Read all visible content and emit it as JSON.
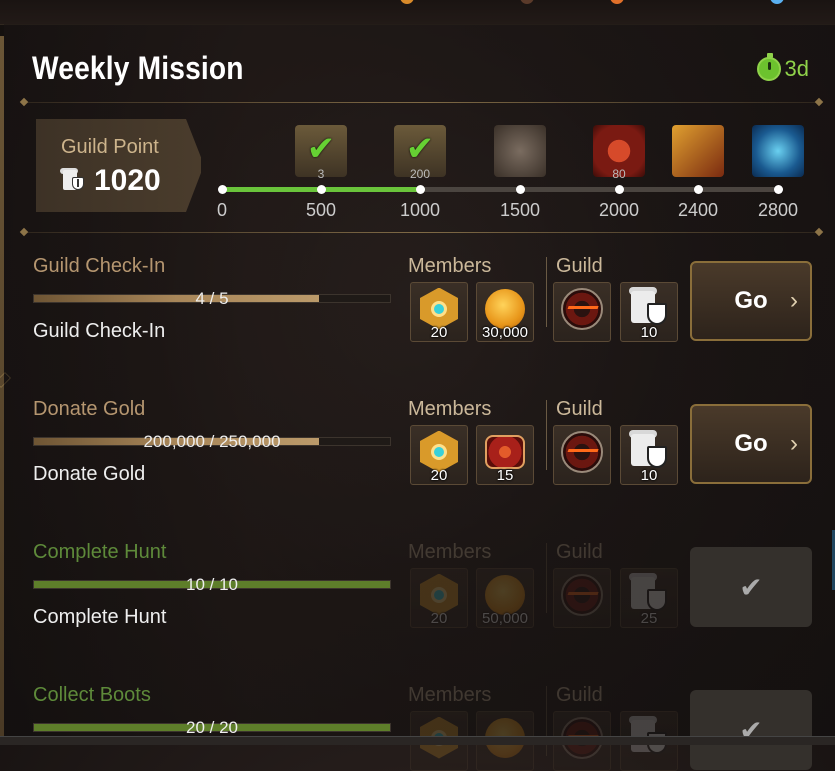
{
  "window": {
    "title": "Weekly Mission",
    "timer": "3d"
  },
  "guild_point": {
    "label": "Guild Point",
    "value": "1020",
    "progress_fraction": 0.3643
  },
  "milestones": [
    {
      "value": "0"
    },
    {
      "value": "500",
      "count": "3",
      "claimed": true,
      "icon": "check-reward-icon"
    },
    {
      "value": "1000",
      "count": "200",
      "claimed": true,
      "icon": "check-reward-icon"
    },
    {
      "value": "1500",
      "count": "",
      "claimed": false,
      "icon": "chest-icon"
    },
    {
      "value": "2000",
      "count": "80",
      "claimed": false,
      "icon": "ring-icon"
    },
    {
      "value": "2400",
      "count": "",
      "claimed": false,
      "icon": "boots-icon"
    },
    {
      "value": "2800",
      "count": "",
      "claimed": false,
      "icon": "blue-chest-icon"
    }
  ],
  "labels": {
    "members": "Members",
    "guild": "Guild",
    "go": "Go"
  },
  "missions": [
    {
      "title": "Guild Check-In",
      "progress_text": "4 / 5",
      "progress": 0.8,
      "desc": "Guild Check-In",
      "member_rewards": [
        {
          "icon": "medal-icon",
          "qty": "20"
        },
        {
          "icon": "gold-coin-icon",
          "qty": "30,000"
        }
      ],
      "guild_rewards": [
        {
          "icon": "lava-orb-icon",
          "qty": ""
        },
        {
          "icon": "guild-scroll-icon",
          "qty": "10"
        }
      ],
      "completed": false
    },
    {
      "title": "Donate Gold",
      "progress_text": "200,000 / 250,000",
      "progress": 0.8,
      "desc": "Donate Gold",
      "member_rewards": [
        {
          "icon": "medal-icon",
          "qty": "20"
        },
        {
          "icon": "ring-icon",
          "qty": "15"
        }
      ],
      "guild_rewards": [
        {
          "icon": "lava-orb-icon",
          "qty": ""
        },
        {
          "icon": "guild-scroll-icon",
          "qty": "10"
        }
      ],
      "completed": false
    },
    {
      "title": "Complete Hunt",
      "progress_text": "10 / 10",
      "progress": 1.0,
      "desc": "Complete Hunt",
      "member_rewards": [
        {
          "icon": "medal-icon",
          "qty": "20"
        },
        {
          "icon": "gold-coin-icon",
          "qty": "50,000"
        }
      ],
      "guild_rewards": [
        {
          "icon": "lava-orb-icon",
          "qty": ""
        },
        {
          "icon": "guild-scroll-icon",
          "qty": "25"
        }
      ],
      "completed": true
    },
    {
      "title": "Collect Boots",
      "progress_text": "20 / 20",
      "progress": 1.0,
      "desc": "",
      "member_rewards": [
        {
          "icon": "medal-icon",
          "qty": ""
        },
        {
          "icon": "gold-coin-icon",
          "qty": ""
        }
      ],
      "guild_rewards": [
        {
          "icon": "lava-orb-icon",
          "qty": ""
        },
        {
          "icon": "guild-scroll-icon",
          "qty": ""
        }
      ],
      "completed": true
    }
  ],
  "colors": {
    "accent_green": "#8fd24a",
    "progress_green": "#6ac43b",
    "gold_border": "#8a6e3a"
  }
}
